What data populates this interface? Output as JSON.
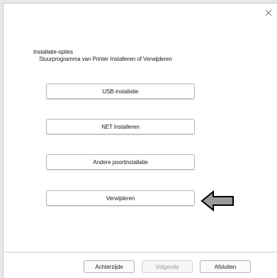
{
  "dialog": {
    "close_label": "×"
  },
  "header": {
    "title": "Installatie-opties",
    "subtitle": "Stuurprogramma van Printer Installeren of Verwijderen"
  },
  "options": [
    {
      "label": "USB-installatie"
    },
    {
      "label": "NET Installeren"
    },
    {
      "label": "Andere poortinstallatie"
    },
    {
      "label": "Verwijderen"
    }
  ],
  "footer": {
    "back_label": "Achterzijde",
    "next_label": "Volgende",
    "finish_label": "Afsluiten"
  },
  "colors": {
    "arrow_fill": "#9a9a9a",
    "arrow_stroke": "#000000"
  },
  "icons": {
    "close": "close-icon",
    "pointer": "left-arrow-icon"
  }
}
